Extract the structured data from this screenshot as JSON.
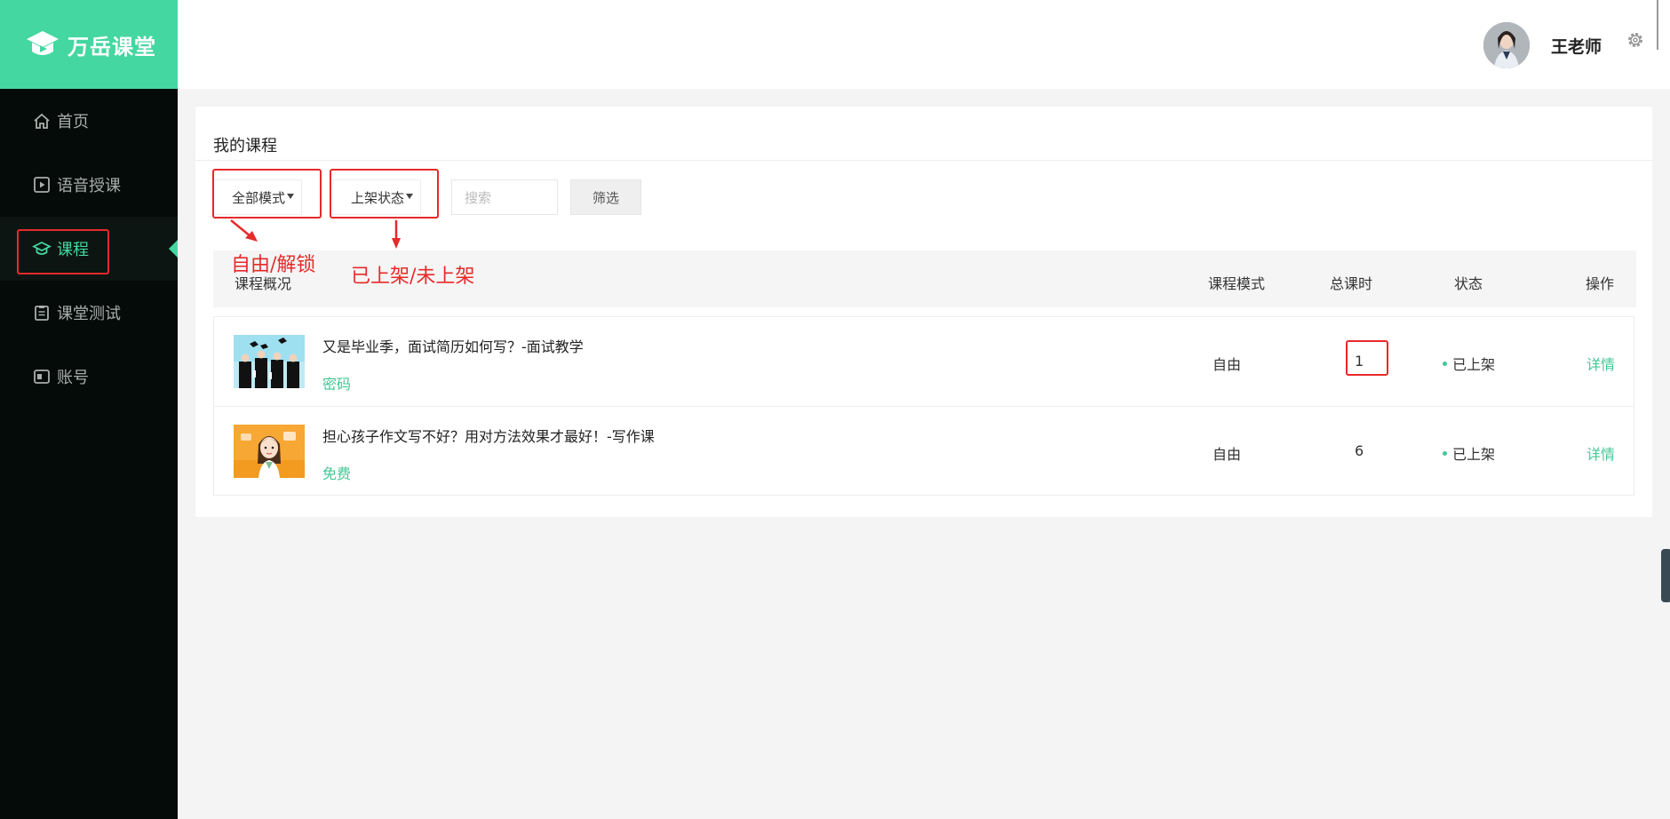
{
  "sidebar": {
    "logo_text": "万岳课堂",
    "items": [
      {
        "label": "首页",
        "icon": "home-icon"
      },
      {
        "label": "语音授课",
        "icon": "play-square-icon"
      },
      {
        "label": "课程",
        "icon": "graduation-cap-icon",
        "active": true
      },
      {
        "label": "课堂测试",
        "icon": "clipboard-icon"
      },
      {
        "label": "账号",
        "icon": "id-card-icon"
      }
    ]
  },
  "header": {
    "user_name": "王老师"
  },
  "main": {
    "title": "我的课程",
    "filters": {
      "mode_select": "全部模式",
      "status_select": "上架状态",
      "search_placeholder": "搜索",
      "filter_button": "筛选"
    },
    "annotations": {
      "mode_note": "自由/解锁",
      "status_note": "已上架/未上架"
    },
    "table": {
      "headers": {
        "overview": "课程概况",
        "mode": "课程模式",
        "hours": "总课时",
        "status": "状态",
        "action": "操作"
      },
      "rows": [
        {
          "title": "又是毕业季，面试简历如何写？-面试教学",
          "tag": "密码",
          "mode": "自由",
          "hours": "1",
          "status": "已上架",
          "action": "详情"
        },
        {
          "title": "担心孩子作文写不好？用对方法效果才最好！-写作课",
          "tag": "免费",
          "mode": "自由",
          "hours": "6",
          "status": "已上架",
          "action": "详情"
        }
      ]
    }
  },
  "colors": {
    "accent": "#44d7a1",
    "sidebar_bg": "#050b09",
    "annotation": "#e62a2a"
  }
}
